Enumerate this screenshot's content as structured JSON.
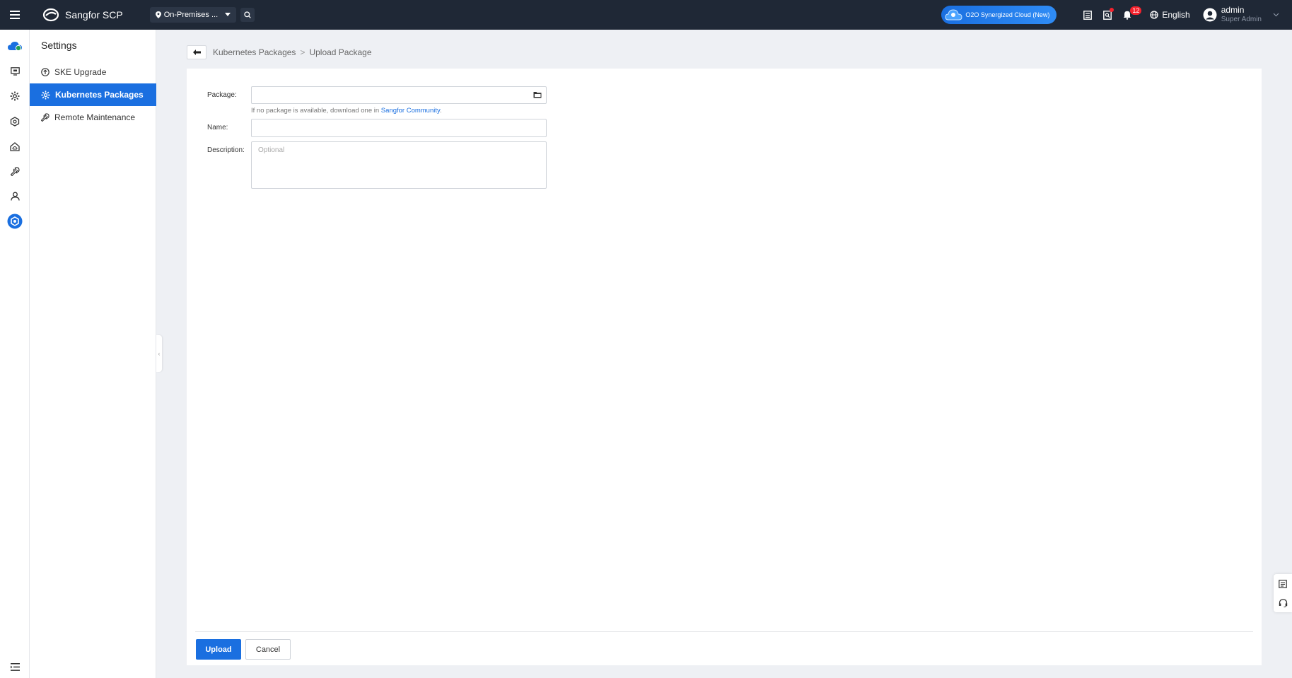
{
  "topbar": {
    "brand_name": "Sangfor SCP",
    "region_label": "On-Premises ...",
    "o2o_label": "O2O Synergized Cloud (New)",
    "notification_count": "12",
    "language": "English",
    "user_name": "admin",
    "user_role": "Super Admin"
  },
  "rail": {
    "icons": [
      "cloud-icon",
      "monitor-icon",
      "gear-cluster-icon",
      "hexagon-network-icon",
      "cloud-home-icon",
      "wrench-icon",
      "user-icon",
      "settings-active-icon"
    ],
    "active_color": "#1a6fe0"
  },
  "subnav": {
    "title": "Settings",
    "items": [
      {
        "label": "SKE Upgrade",
        "icon": "upgrade-icon",
        "active": false
      },
      {
        "label": "Kubernetes Packages",
        "icon": "kubernetes-gear-icon",
        "active": true
      },
      {
        "label": "Remote Maintenance",
        "icon": "wrench-icon",
        "active": false
      }
    ]
  },
  "breadcrumb": {
    "parent": "Kubernetes Packages",
    "separator": ">",
    "current": "Upload Package"
  },
  "form": {
    "package_label": "Package:",
    "package_value": "",
    "hint_text": "If no package is available, download one in ",
    "hint_link": "Sangfor Community",
    "hint_end": ".",
    "name_label": "Name:",
    "name_value": "",
    "description_label": "Description:",
    "description_placeholder": "Optional"
  },
  "actions": {
    "upload_label": "Upload",
    "cancel_label": "Cancel"
  },
  "colors": {
    "topbar_bg": "#1f2836",
    "accent": "#1a6fe0",
    "page_bg": "#eef0f4"
  }
}
